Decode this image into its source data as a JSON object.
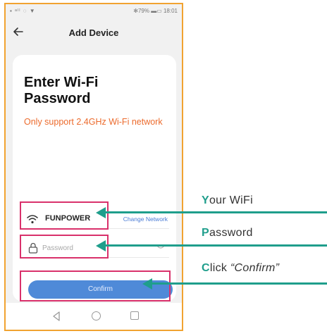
{
  "status_bar": {
    "left": "▪ ᵃˡˡ ◌ ▼",
    "right": "✻79% ▬▭ 18:01"
  },
  "app_bar": {
    "title": "Add Device"
  },
  "form": {
    "heading": "Enter Wi-Fi\nPassword",
    "notice": "Only support 2.4GHz Wi-Fi network",
    "ssid": "FUNPOWER",
    "change_network": "Change Network",
    "password_placeholder": "Password",
    "confirm_label": "Confirm"
  },
  "annotations": [
    {
      "first": "Y",
      "rest": "our WiFi"
    },
    {
      "first": "P",
      "rest": "assword"
    },
    {
      "first": "C",
      "rest": "lick ",
      "italic": "“Confirm”"
    }
  ],
  "colors": {
    "frame": "#f1a331",
    "highlight_box": "#d9316b",
    "arrow": "#1f9e8c",
    "notice_text": "#ec6b2d",
    "button": "#4f8ad8"
  },
  "icons": [
    "back-arrow-icon",
    "wifi-icon",
    "lock-icon",
    "eye-icon",
    "nav-back-icon",
    "nav-home-icon",
    "nav-recent-icon"
  ]
}
